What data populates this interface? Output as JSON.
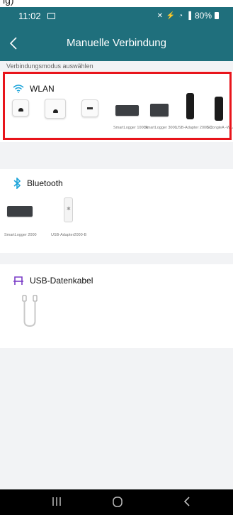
{
  "status_bar": {
    "time": "11:02",
    "right_text": "80%"
  },
  "top_crop_text": "ig)",
  "header": {
    "title": "Manuelle Verbindung"
  },
  "section_caption": "Verbindungsmodus auswählen",
  "wlan": {
    "title": "WLAN",
    "devices": [
      {
        "label": ""
      },
      {
        "label": ""
      },
      {
        "label": ""
      },
      {
        "label": "SmartLogger 1000A"
      },
      {
        "label": "SmartLogger 3000"
      },
      {
        "label": "USB-Adapter 2000-C"
      },
      {
        "label": "SDongleA -WLAN-EU"
      }
    ]
  },
  "bluetooth": {
    "title": "Bluetooth",
    "devices": [
      {
        "label": "SmartLogger 2000"
      },
      {
        "label": "USB-Adapter2000-B"
      }
    ]
  },
  "usb": {
    "title": "USB-Datenkabel"
  },
  "colors": {
    "header_bg": "#1f6f7c",
    "accent_blue": "#1aa3d9",
    "usb_icon": "#7a3cc7",
    "highlight": "#e8141b"
  }
}
